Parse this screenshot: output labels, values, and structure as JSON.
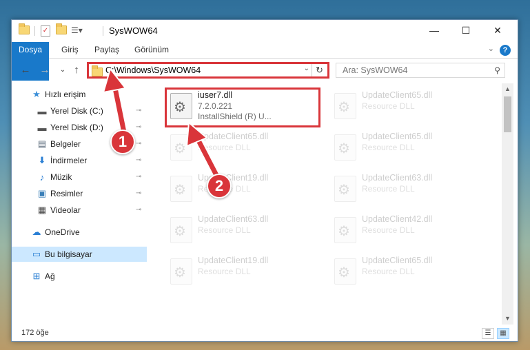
{
  "window": {
    "title": "SysWOW64",
    "minimize_glyph": "—",
    "maximize_glyph": "☐",
    "close_glyph": "✕"
  },
  "ribbon": {
    "tabs": [
      "Dosya",
      "Giriş",
      "Paylaş",
      "Görünüm"
    ],
    "help_glyph": "?",
    "collapse_glyph": "⌄"
  },
  "toolbar": {
    "back_glyph": "←",
    "forward_glyph": "→",
    "recent_glyph": "⌄",
    "up_glyph": "↑"
  },
  "address": {
    "path": "C:\\Windows\\SysWOW64",
    "dropdown_glyph": "⌄",
    "refresh_glyph": "↻"
  },
  "search": {
    "placeholder": "Ara: SysWOW64",
    "icon_glyph": "⚲"
  },
  "sidebar": {
    "items": [
      {
        "label": "Hızlı erişim",
        "icon": "star-icon",
        "glyph": "★",
        "color": "#3b8fd8",
        "pinned": false
      },
      {
        "label": "Yerel Disk (C:)",
        "icon": "drive-icon",
        "glyph": "▬",
        "color": "#555555",
        "pinned": true
      },
      {
        "label": "Yerel Disk (D:)",
        "icon": "drive-icon",
        "glyph": "▬",
        "color": "#555555",
        "pinned": true
      },
      {
        "label": "Belgeler",
        "icon": "documents-icon",
        "glyph": "▤",
        "color": "#5a6b7b",
        "pinned": true
      },
      {
        "label": "İndirmeler",
        "icon": "download-icon",
        "glyph": "⬇",
        "color": "#2a7fd4",
        "pinned": true
      },
      {
        "label": "Müzik",
        "icon": "music-icon",
        "glyph": "♪",
        "color": "#2a7fd4",
        "pinned": true
      },
      {
        "label": "Resimler",
        "icon": "pictures-icon",
        "glyph": "▣",
        "color": "#3a7fb8",
        "pinned": true
      },
      {
        "label": "Videolar",
        "icon": "videos-icon",
        "glyph": "▦",
        "color": "#444444",
        "pinned": true
      },
      {
        "label": "OneDrive",
        "icon": "onedrive-icon",
        "glyph": "☁",
        "color": "#2a7fd4",
        "pinned": false
      },
      {
        "label": "Bu bilgisayar",
        "icon": "computer-icon",
        "glyph": "▭",
        "color": "#2a7fd4",
        "pinned": false,
        "selected": true
      },
      {
        "label": "Ağ",
        "icon": "network-icon",
        "glyph": "⊞",
        "color": "#2a7fd4",
        "pinned": false
      }
    ],
    "pin_glyph": "📌"
  },
  "files": [
    {
      "name": "iuser7.dll",
      "version": "7.2.0.221",
      "description": "InstallShield (R) U...",
      "highlighted": true
    },
    {
      "name": "UpdateClient65.dll",
      "description": "Resource DLL"
    },
    {
      "name": "UpdateClient65.dll",
      "description": "Resource DLL"
    },
    {
      "name": "UpdateClient65.dll",
      "description": "Resource DLL"
    },
    {
      "name": "UpdateClient19.dll",
      "description": "Resource DLL"
    },
    {
      "name": "UpdateClient63.dll",
      "description": "Resource DLL"
    },
    {
      "name": "UpdateClient63.dll",
      "description": "Resource DLL"
    },
    {
      "name": "UpdateClient42.dll",
      "description": "Resource DLL"
    },
    {
      "name": "UpdateClient19.dll",
      "description": "Resource DLL"
    },
    {
      "name": "UpdateClient65.dll",
      "description": "Resource DLL"
    }
  ],
  "status": {
    "item_count": "172 öğe"
  },
  "callouts": {
    "step1": "1",
    "step2": "2",
    "color": "#d9353a"
  }
}
